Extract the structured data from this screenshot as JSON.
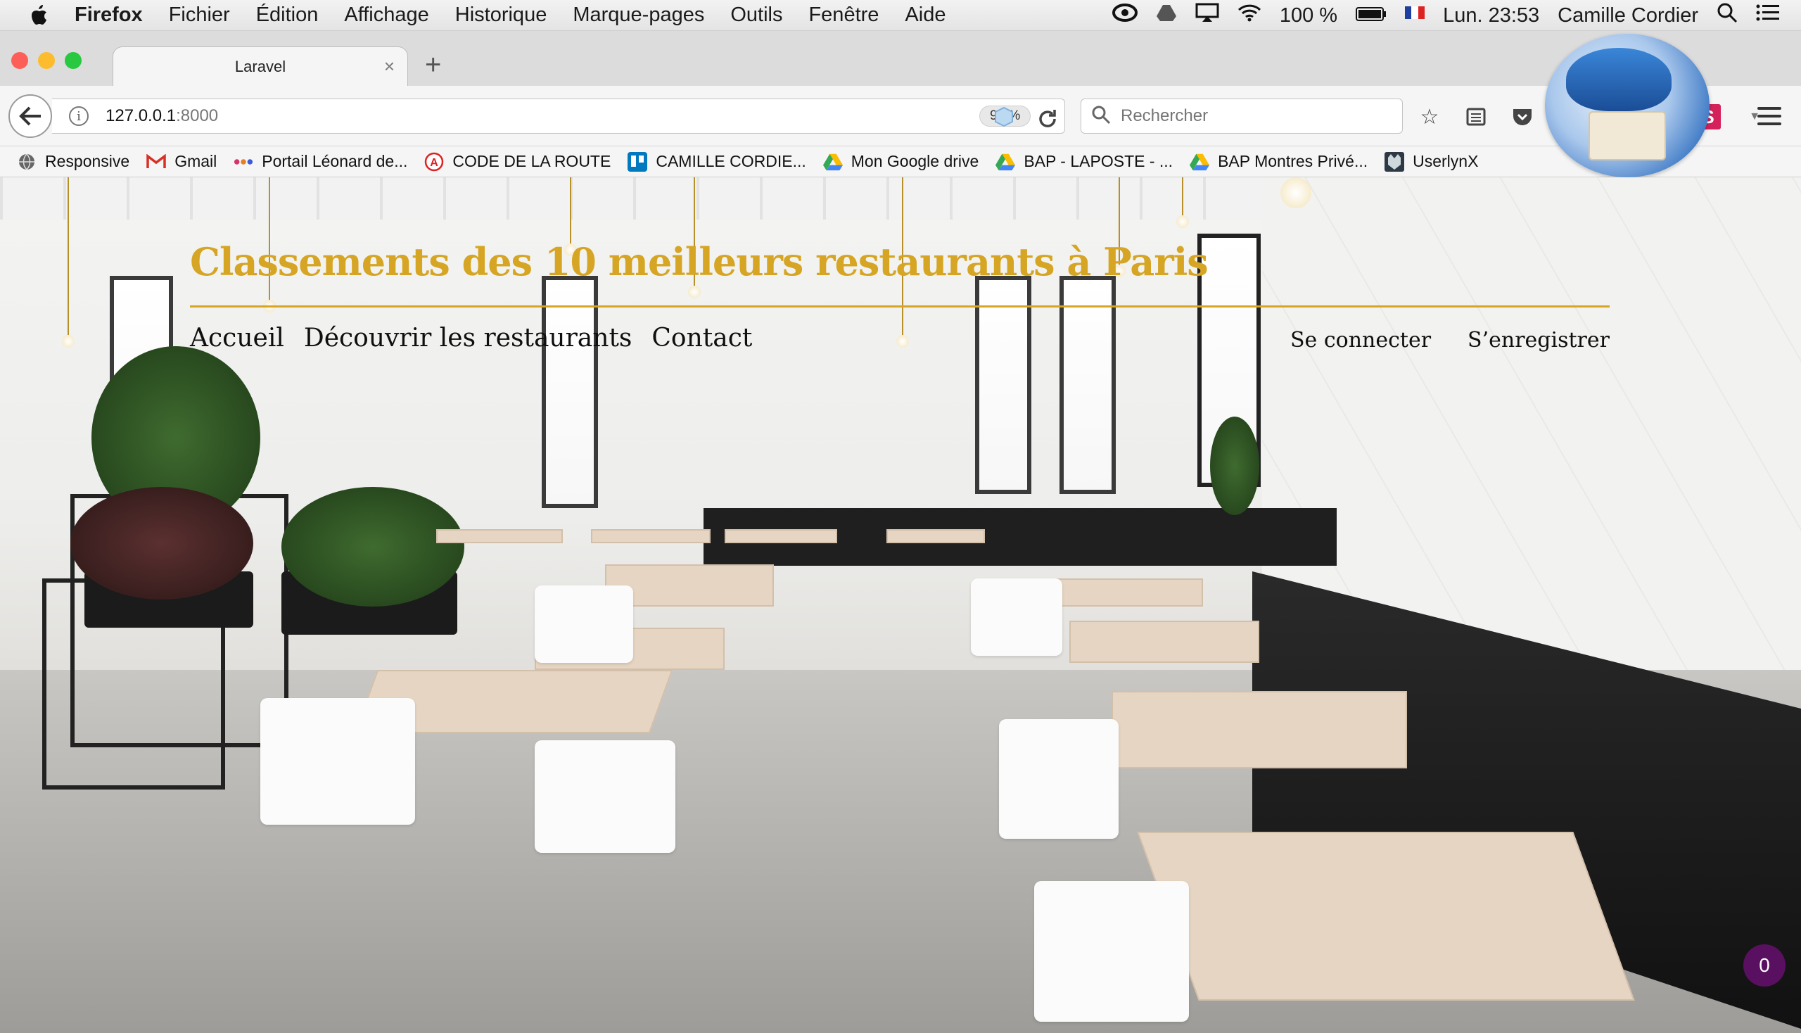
{
  "menubar": {
    "app": "Firefox",
    "items": [
      "Fichier",
      "Édition",
      "Affichage",
      "Historique",
      "Marque-pages",
      "Outils",
      "Fenêtre",
      "Aide"
    ],
    "battery": "100 %",
    "clock": "Lun. 23:53",
    "user": "Camille Cordier"
  },
  "tab": {
    "title": "Laravel"
  },
  "urlbar": {
    "host": "127.0.0.1",
    "port": ":8000",
    "zoom": "90 %"
  },
  "search": {
    "placeholder": "Rechercher"
  },
  "bookmarks": [
    {
      "label": "Responsive",
      "icon": "globe-icon"
    },
    {
      "label": "Gmail",
      "icon": "gmail-icon"
    },
    {
      "label": "Portail Léonard de...",
      "icon": "dots-icon"
    },
    {
      "label": "CODE DE LA ROUTE",
      "icon": "code-route-icon"
    },
    {
      "label": "CAMILLE CORDIE...",
      "icon": "trello-icon"
    },
    {
      "label": "Mon Google drive",
      "icon": "drive-icon"
    },
    {
      "label": "BAP - LAPOSTE - ...",
      "icon": "drive-icon"
    },
    {
      "label": "BAP Montres Privé...",
      "icon": "drive-icon"
    },
    {
      "label": "UserlynX",
      "icon": "userlynx-icon"
    }
  ],
  "site": {
    "title": "Classements des 10 meilleurs restaurants à Paris",
    "nav": [
      "Accueil",
      "Découvrir les restaurants",
      "Contact"
    ],
    "login": "Se connecter",
    "register": "S’enregistrer",
    "accent": "#d6a524"
  },
  "badge": {
    "count": "0"
  }
}
